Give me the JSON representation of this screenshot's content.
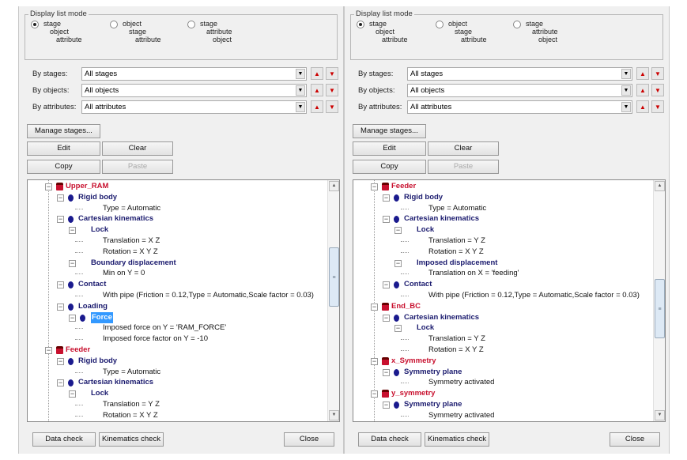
{
  "common": {
    "group_title": "Display list mode",
    "radios": [
      {
        "lines": [
          "stage",
          "object",
          "attribute"
        ],
        "selected": true
      },
      {
        "lines": [
          "object",
          "stage",
          "attribute"
        ],
        "selected": false
      },
      {
        "lines": [
          "stage",
          "attribute",
          "object"
        ],
        "selected": false
      }
    ],
    "filters": [
      {
        "label": "By stages:",
        "value": "All stages"
      },
      {
        "label": "By objects:",
        "value": "All objects"
      },
      {
        "label": "By attributes:",
        "value": "All attributes"
      }
    ],
    "buttons": {
      "manage": "Manage stages...",
      "edit": "Edit",
      "clear": "Clear",
      "copy": "Copy",
      "paste": "Paste",
      "data_check": "Data check",
      "kinematics_check": "Kinematics check",
      "close": "Close"
    },
    "icons": {
      "up": "▲",
      "down": "▼",
      "combo": "▼",
      "scroll_up": "▲",
      "scroll_down": "▼",
      "grip": "≡"
    }
  },
  "colors": {
    "object": "#c8102e",
    "attribute": "#1a1a6e",
    "selection": "#3399ff"
  },
  "panels": [
    {
      "scroll_position": 0.35,
      "tree": [
        {
          "kind": "obj",
          "text": "Upper_RAM"
        },
        {
          "kind": "attr",
          "text": "Rigid body"
        },
        {
          "kind": "val",
          "text": "Type = Automatic"
        },
        {
          "kind": "attr",
          "text": "Cartesian kinematics"
        },
        {
          "kind": "sub",
          "text": "Lock"
        },
        {
          "kind": "val",
          "text": "Translation = X Z"
        },
        {
          "kind": "val",
          "text": "Rotation = X Y Z"
        },
        {
          "kind": "sub",
          "text": "Boundary displacement"
        },
        {
          "kind": "val",
          "text": "Min on Y = 0"
        },
        {
          "kind": "attr",
          "text": "Contact"
        },
        {
          "kind": "val",
          "text": "With pipe (Friction = 0.12,Type = Automatic,Scale factor = 0.03)"
        },
        {
          "kind": "attr",
          "text": "Loading"
        },
        {
          "kind": "subicon",
          "text": "Force",
          "selected": true
        },
        {
          "kind": "val",
          "text": "Imposed force on Y = 'RAM_FORCE'"
        },
        {
          "kind": "val",
          "text": "Imposed force factor on Y = -10"
        },
        {
          "kind": "obj",
          "text": "Feeder"
        },
        {
          "kind": "attr",
          "text": "Rigid body"
        },
        {
          "kind": "val",
          "text": "Type = Automatic"
        },
        {
          "kind": "attr",
          "text": "Cartesian kinematics"
        },
        {
          "kind": "sub",
          "text": "Lock"
        },
        {
          "kind": "val",
          "text": "Translation = Y Z"
        },
        {
          "kind": "val",
          "text": "Rotation = X Y Z"
        }
      ]
    },
    {
      "scroll_position": 0.55,
      "tree": [
        {
          "kind": "obj",
          "text": "Feeder"
        },
        {
          "kind": "attr",
          "text": "Rigid body"
        },
        {
          "kind": "val",
          "text": "Type = Automatic"
        },
        {
          "kind": "attr",
          "text": "Cartesian kinematics"
        },
        {
          "kind": "sub",
          "text": "Lock"
        },
        {
          "kind": "val",
          "text": "Translation = Y Z"
        },
        {
          "kind": "val",
          "text": "Rotation = X Y Z"
        },
        {
          "kind": "sub",
          "text": "Imposed displacement"
        },
        {
          "kind": "val",
          "text": "Translation on X = 'feeding'"
        },
        {
          "kind": "attr",
          "text": "Contact"
        },
        {
          "kind": "val",
          "text": "With pipe (Friction = 0.12,Type = Automatic,Scale factor = 0.03)"
        },
        {
          "kind": "obj",
          "text": "End_BC"
        },
        {
          "kind": "attr",
          "text": "Cartesian kinematics"
        },
        {
          "kind": "sub",
          "text": "Lock"
        },
        {
          "kind": "val",
          "text": "Translation = Y Z"
        },
        {
          "kind": "val",
          "text": "Rotation = X Y Z"
        },
        {
          "kind": "obj",
          "text": "x_Symmetry"
        },
        {
          "kind": "attr",
          "text": "Symmetry plane"
        },
        {
          "kind": "val",
          "text": "Symmetry activated"
        },
        {
          "kind": "obj",
          "text": "y_symmetry"
        },
        {
          "kind": "attr",
          "text": "Symmetry plane"
        },
        {
          "kind": "val",
          "text": "Symmetry activated"
        }
      ]
    }
  ]
}
